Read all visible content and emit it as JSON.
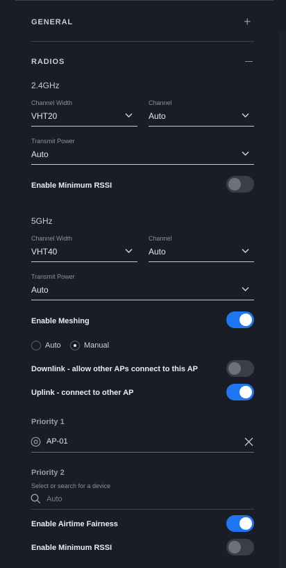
{
  "sections": {
    "general": {
      "title": "GENERAL",
      "icon": "plus-icon"
    },
    "radios": {
      "title": "RADIOS",
      "icon": "minus-icon"
    }
  },
  "band_24": {
    "title": "2.4GHz",
    "channel_width": {
      "label": "Channel Width",
      "value": "VHT20"
    },
    "channel": {
      "label": "Channel",
      "value": "Auto"
    },
    "transmit_power": {
      "label": "Transmit Power",
      "value": "Auto"
    },
    "min_rssi": {
      "label": "Enable Minimum RSSI",
      "enabled": false
    }
  },
  "band_5": {
    "title": "5GHz",
    "channel_width": {
      "label": "Channel Width",
      "value": "VHT40"
    },
    "channel": {
      "label": "Channel",
      "value": "Auto"
    },
    "transmit_power": {
      "label": "Transmit Power",
      "value": "Auto"
    }
  },
  "meshing": {
    "label": "Enable Meshing",
    "enabled": true,
    "mode_options": [
      "Auto",
      "Manual"
    ],
    "selected_mode": "Manual",
    "downlink": {
      "label": "Downlink - allow other APs connect to this AP",
      "enabled": false
    },
    "uplink": {
      "label": "Uplink - connect to other AP",
      "enabled": true
    },
    "priority1": {
      "label": "Priority 1",
      "value": "AP-01"
    },
    "priority2": {
      "label": "Priority 2",
      "hint": "Select or search for a device",
      "placeholder": "Auto"
    }
  },
  "airtime_fairness": {
    "label": "Enable Airtime Fairness",
    "enabled": true
  },
  "min_rssi_bottom": {
    "label": "Enable Minimum RSSI",
    "enabled": false
  },
  "colors": {
    "accent": "#1f74f0",
    "background": "#1b1d26"
  }
}
